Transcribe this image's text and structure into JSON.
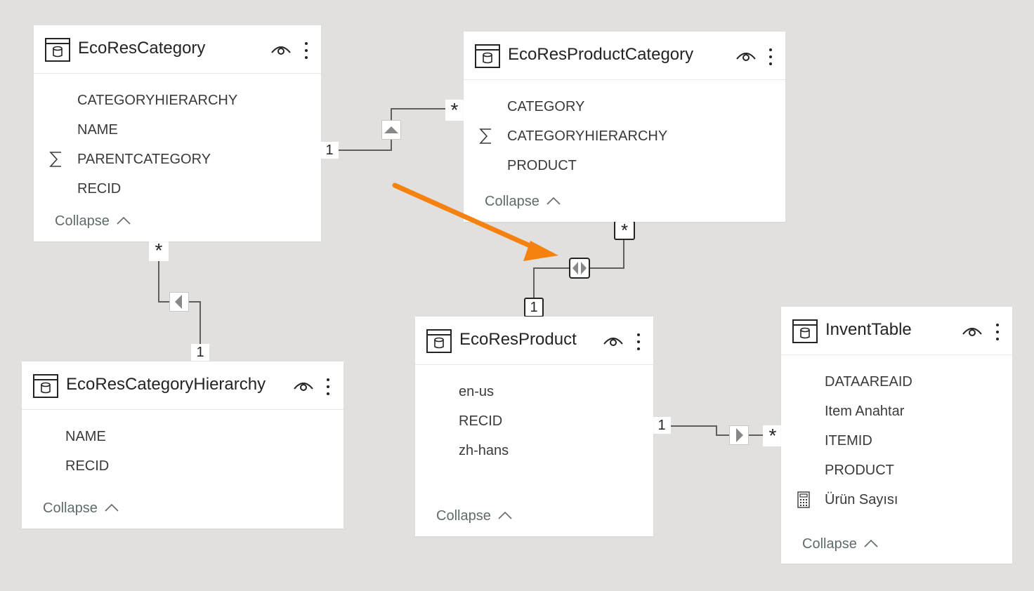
{
  "tables": [
    {
      "title": "EcoResCategory",
      "fields": [
        {
          "name": "CATEGORYHIERARCHY",
          "icon": ""
        },
        {
          "name": "NAME",
          "icon": ""
        },
        {
          "name": "PARENTCATEGORY",
          "icon": "sigma-icon"
        },
        {
          "name": "RECID",
          "icon": ""
        }
      ],
      "collapse_label": "Collapse"
    },
    {
      "title": "EcoResProductCategory",
      "fields": [
        {
          "name": "CATEGORY",
          "icon": ""
        },
        {
          "name": "CATEGORYHIERARCHY",
          "icon": "sigma-icon"
        },
        {
          "name": "PRODUCT",
          "icon": ""
        }
      ],
      "collapse_label": "Collapse"
    },
    {
      "title": "EcoResCategoryHierarchy",
      "fields": [
        {
          "name": "NAME",
          "icon": ""
        },
        {
          "name": "RECID",
          "icon": ""
        }
      ],
      "collapse_label": "Collapse"
    },
    {
      "title": "EcoResProduct",
      "fields": [
        {
          "name": "en-us",
          "icon": ""
        },
        {
          "name": "RECID",
          "icon": ""
        },
        {
          "name": "zh-hans",
          "icon": ""
        }
      ],
      "collapse_label": "Collapse"
    },
    {
      "title": "InventTable",
      "fields": [
        {
          "name": "DATAAREAID",
          "icon": ""
        },
        {
          "name": "Item Anahtar",
          "icon": ""
        },
        {
          "name": "ITEMID",
          "icon": ""
        },
        {
          "name": "PRODUCT",
          "icon": ""
        },
        {
          "name": "Ürün Sayısı",
          "icon": "calculator-icon"
        }
      ],
      "collapse_label": "Collapse"
    }
  ],
  "relationships": [
    {
      "one_label": "1",
      "many_label": "*",
      "filter_direction": "single-up"
    },
    {
      "one_label": "1",
      "many_label": "*",
      "filter_direction": "single-left"
    },
    {
      "one_label": "1",
      "many_label": "*",
      "filter_direction": "both"
    },
    {
      "one_label": "1",
      "many_label": "*",
      "filter_direction": "single-right"
    }
  ],
  "annotation": {
    "type": "arrow-icon",
    "color": "#f5820f"
  },
  "colors": {
    "canvas": "#e1e0df",
    "card": "#ffffff",
    "line": "#605e5c",
    "accent": "#f5820f"
  }
}
